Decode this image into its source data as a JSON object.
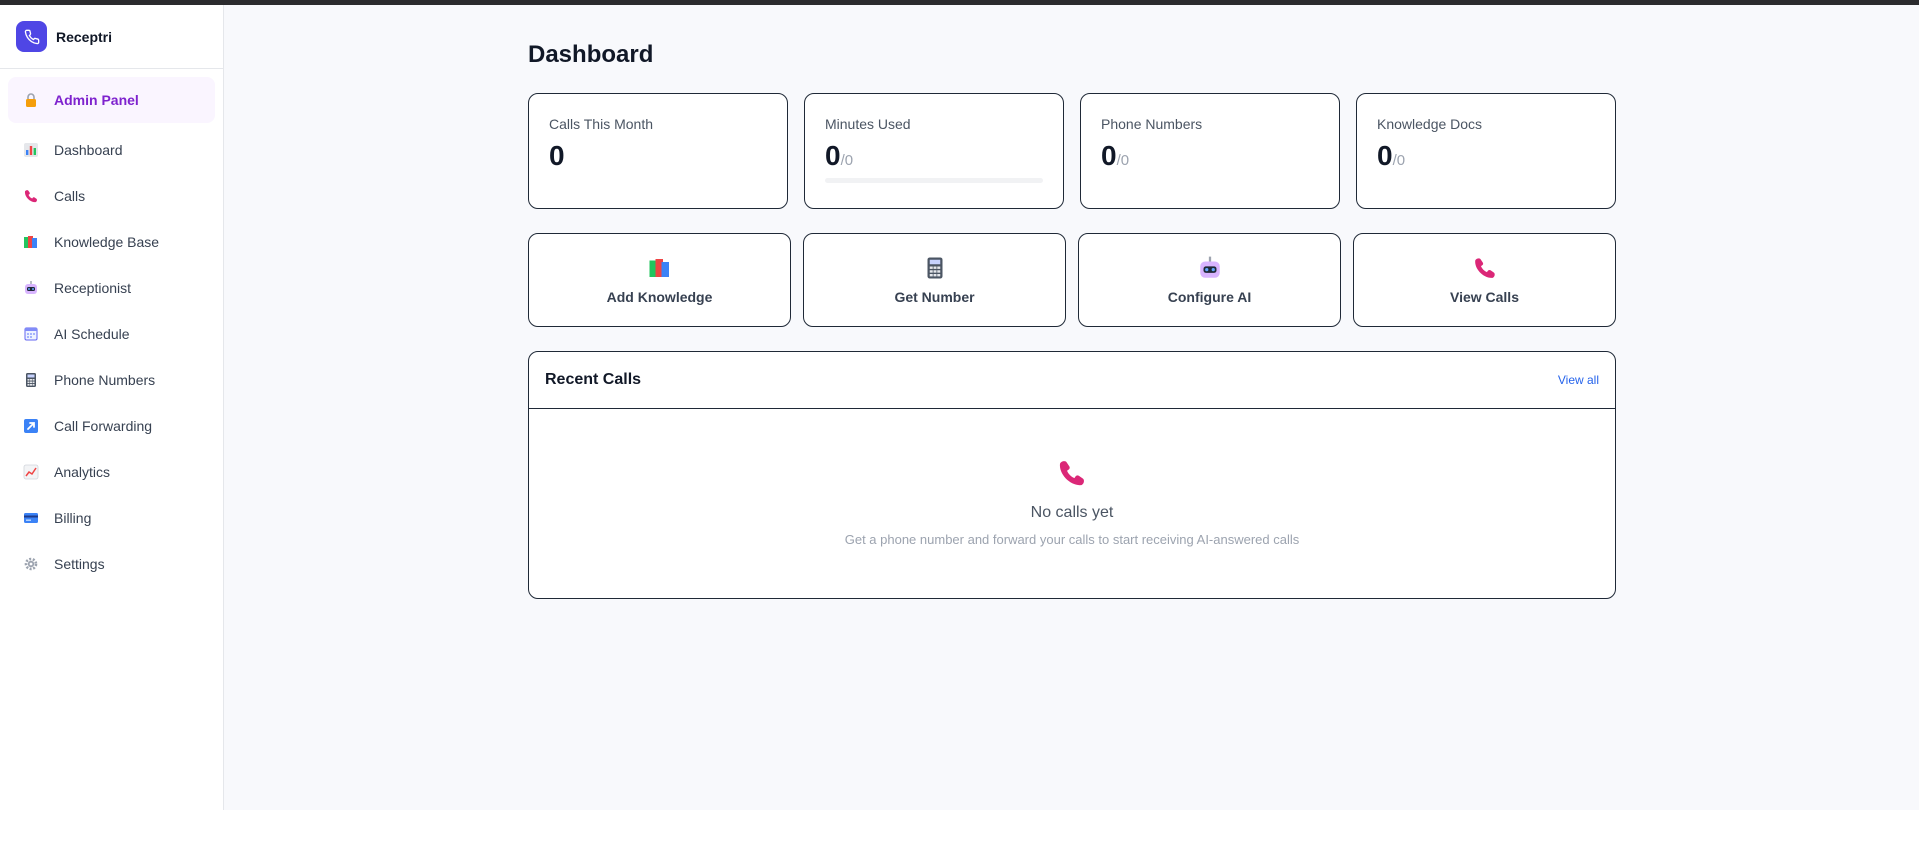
{
  "brand": {
    "name": "Receptri",
    "icon": "phone-icon",
    "color": "#4f46e5"
  },
  "sidebar": {
    "items": [
      {
        "label": "Admin Panel",
        "icon": "lock-icon"
      },
      {
        "label": "Dashboard",
        "icon": "bar-chart-icon"
      },
      {
        "label": "Calls",
        "icon": "phone-receiver-icon"
      },
      {
        "label": "Knowledge Base",
        "icon": "books-icon"
      },
      {
        "label": "Receptionist",
        "icon": "robot-icon"
      },
      {
        "label": "AI Schedule",
        "icon": "calendar-icon"
      },
      {
        "label": "Phone Numbers",
        "icon": "calculator-icon"
      },
      {
        "label": "Call Forwarding",
        "icon": "arrow-up-right-icon"
      },
      {
        "label": "Analytics",
        "icon": "line-chart-icon"
      },
      {
        "label": "Billing",
        "icon": "credit-card-icon"
      },
      {
        "label": "Settings",
        "icon": "gear-icon"
      }
    ]
  },
  "page": {
    "title": "Dashboard"
  },
  "stats": [
    {
      "label": "Calls This Month",
      "value": "0",
      "sub": ""
    },
    {
      "label": "Minutes Used",
      "value": "0",
      "sub": "/0",
      "progress": 0
    },
    {
      "label": "Phone Numbers",
      "value": "0",
      "sub": "/0"
    },
    {
      "label": "Knowledge Docs",
      "value": "0",
      "sub": "/0"
    }
  ],
  "actions": [
    {
      "label": "Add Knowledge",
      "icon": "books-icon"
    },
    {
      "label": "Get Number",
      "icon": "calculator-icon"
    },
    {
      "label": "Configure AI",
      "icon": "robot-icon"
    },
    {
      "label": "View Calls",
      "icon": "phone-receiver-icon"
    }
  ],
  "recent": {
    "title": "Recent Calls",
    "link": "View all",
    "empty_title": "No calls yet",
    "empty_sub": "Get a phone number and forward your calls to start receiving AI-answered calls"
  },
  "colors": {
    "accent": "#4f46e5",
    "admin": "#7e22ce",
    "phone": "#db2777"
  }
}
